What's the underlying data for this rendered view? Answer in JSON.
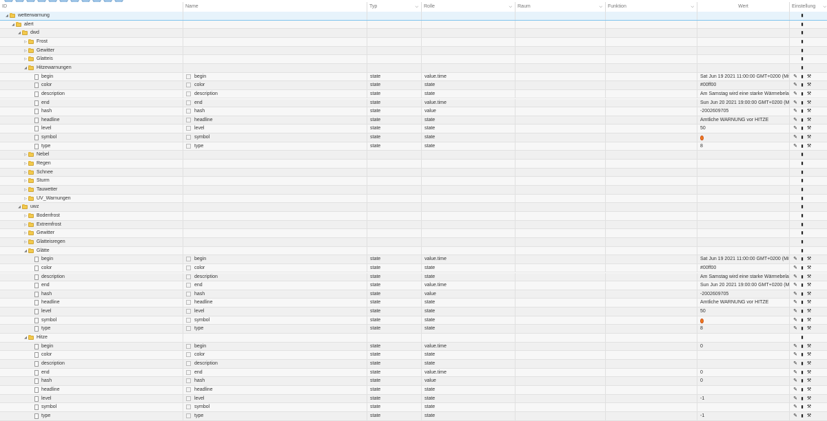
{
  "columns": {
    "id": "ID",
    "name": "Name",
    "typ": "Typ",
    "rolle": "Rolle",
    "raum": "Raum",
    "funktion": "Funktion",
    "wert": "Wert",
    "einstellung": "Einstellung"
  },
  "rows": [
    {
      "id": "wetterwarnung",
      "kind": "folder",
      "level": 0,
      "expanded": true,
      "selected": true
    },
    {
      "id": "alert",
      "kind": "folder",
      "level": 1,
      "expanded": true
    },
    {
      "id": "dwd",
      "kind": "folder",
      "level": 2,
      "expanded": true
    },
    {
      "id": "Frost",
      "kind": "folder",
      "level": 3,
      "expanded": false
    },
    {
      "id": "Gewitter",
      "kind": "folder",
      "level": 3,
      "expanded": false
    },
    {
      "id": "Glatteis",
      "kind": "folder",
      "level": 3,
      "expanded": false
    },
    {
      "id": "Hitzewarnungen",
      "kind": "folder",
      "level": 3,
      "expanded": true
    },
    {
      "id": "begin",
      "kind": "state",
      "level": 4,
      "name": "begin",
      "typ": "state",
      "rolle": "value.time",
      "wert": "Sat Jun 19 2021 11:00:00 GMT+0200 (Mittele"
    },
    {
      "id": "color",
      "kind": "state",
      "level": 4,
      "name": "color",
      "typ": "state",
      "rolle": "state",
      "wert": "#00ff00"
    },
    {
      "id": "description",
      "kind": "state",
      "level": 4,
      "name": "description",
      "typ": "state",
      "rolle": "state",
      "wert": "Am Samstag wird eine starke Wärmebelastur"
    },
    {
      "id": "end",
      "kind": "state",
      "level": 4,
      "name": "end",
      "typ": "state",
      "rolle": "value.time",
      "wert": "Sun Jun 20 2021 19:00:00 GMT+0200 (Mittel"
    },
    {
      "id": "hash",
      "kind": "state",
      "level": 4,
      "name": "hash",
      "typ": "state",
      "rolle": "value",
      "wert": "-2002609705"
    },
    {
      "id": "headline",
      "kind": "state",
      "level": 4,
      "name": "headline",
      "typ": "state",
      "rolle": "state",
      "wert": "Amtliche WARNUNG vor HITZE"
    },
    {
      "id": "level",
      "kind": "state",
      "level": 4,
      "name": "level",
      "typ": "state",
      "rolle": "state",
      "wert": "50"
    },
    {
      "id": "symbol",
      "kind": "state",
      "level": 4,
      "name": "symbol",
      "typ": "state",
      "rolle": "state",
      "wert": "",
      "wert_icon": "fire-icon"
    },
    {
      "id": "type",
      "kind": "state",
      "level": 4,
      "name": "type",
      "typ": "state",
      "rolle": "state",
      "wert": "8"
    },
    {
      "id": "Nebel",
      "kind": "folder",
      "level": 3,
      "expanded": false
    },
    {
      "id": "Regen",
      "kind": "folder",
      "level": 3,
      "expanded": false
    },
    {
      "id": "Schnee",
      "kind": "folder",
      "level": 3,
      "expanded": false
    },
    {
      "id": "Sturm",
      "kind": "folder",
      "level": 3,
      "expanded": false
    },
    {
      "id": "Tauwetter",
      "kind": "folder",
      "level": 3,
      "expanded": false
    },
    {
      "id": "UV_Warnungen",
      "kind": "folder",
      "level": 3,
      "expanded": false
    },
    {
      "id": "uwz",
      "kind": "folder",
      "level": 2,
      "expanded": true
    },
    {
      "id": "Bodenfrost",
      "kind": "folder",
      "level": 3,
      "expanded": false
    },
    {
      "id": "Extremfrost",
      "kind": "folder",
      "level": 3,
      "expanded": false
    },
    {
      "id": "Gewitter",
      "kind": "folder",
      "level": 3,
      "expanded": false
    },
    {
      "id": "Glatteisregen",
      "kind": "folder",
      "level": 3,
      "expanded": false
    },
    {
      "id": "Glätte",
      "kind": "folder",
      "level": 3,
      "expanded": true
    },
    {
      "id": "begin",
      "kind": "state",
      "level": 4,
      "name": "begin",
      "typ": "state",
      "rolle": "value.time",
      "wert": "Sat Jun 19 2021 11:00:00 GMT+0200 (Mittele"
    },
    {
      "id": "color",
      "kind": "state",
      "level": 4,
      "name": "color",
      "typ": "state",
      "rolle": "state",
      "wert": "#00ff00"
    },
    {
      "id": "description",
      "kind": "state",
      "level": 4,
      "name": "description",
      "typ": "state",
      "rolle": "state",
      "wert": "Am Samstag wird eine starke Wärmebelastur"
    },
    {
      "id": "end",
      "kind": "state",
      "level": 4,
      "name": "end",
      "typ": "state",
      "rolle": "value.time",
      "wert": "Sun Jun 20 2021 19:00:00 GMT+0200 (Mittel"
    },
    {
      "id": "hash",
      "kind": "state",
      "level": 4,
      "name": "hash",
      "typ": "state",
      "rolle": "value",
      "wert": "-2002609705"
    },
    {
      "id": "headline",
      "kind": "state",
      "level": 4,
      "name": "headline",
      "typ": "state",
      "rolle": "state",
      "wert": "Amtliche WARNUNG vor HITZE"
    },
    {
      "id": "level",
      "kind": "state",
      "level": 4,
      "name": "level",
      "typ": "state",
      "rolle": "state",
      "wert": "50"
    },
    {
      "id": "symbol",
      "kind": "state",
      "level": 4,
      "name": "symbol",
      "typ": "state",
      "rolle": "state",
      "wert": "",
      "wert_icon": "fire-icon"
    },
    {
      "id": "type",
      "kind": "state",
      "level": 4,
      "name": "type",
      "typ": "state",
      "rolle": "state",
      "wert": "8"
    },
    {
      "id": "Hitze",
      "kind": "folder",
      "level": 3,
      "expanded": true
    },
    {
      "id": "begin",
      "kind": "state",
      "level": 4,
      "name": "begin",
      "typ": "state",
      "rolle": "value.time",
      "wert": "0"
    },
    {
      "id": "color",
      "kind": "state",
      "level": 4,
      "name": "color",
      "typ": "state",
      "rolle": "state",
      "wert": ""
    },
    {
      "id": "description",
      "kind": "state",
      "level": 4,
      "name": "description",
      "typ": "state",
      "rolle": "state",
      "wert": ""
    },
    {
      "id": "end",
      "kind": "state",
      "level": 4,
      "name": "end",
      "typ": "state",
      "rolle": "value.time",
      "wert": "0"
    },
    {
      "id": "hash",
      "kind": "state",
      "level": 4,
      "name": "hash",
      "typ": "state",
      "rolle": "value",
      "wert": "0"
    },
    {
      "id": "headline",
      "kind": "state",
      "level": 4,
      "name": "headline",
      "typ": "state",
      "rolle": "state",
      "wert": ""
    },
    {
      "id": "level",
      "kind": "state",
      "level": 4,
      "name": "level",
      "typ": "state",
      "rolle": "state",
      "wert": "-1"
    },
    {
      "id": "symbol",
      "kind": "state",
      "level": 4,
      "name": "symbol",
      "typ": "state",
      "rolle": "state",
      "wert": ""
    },
    {
      "id": "type",
      "kind": "state",
      "level": 4,
      "name": "type",
      "typ": "state",
      "rolle": "state",
      "wert": "-1"
    }
  ]
}
